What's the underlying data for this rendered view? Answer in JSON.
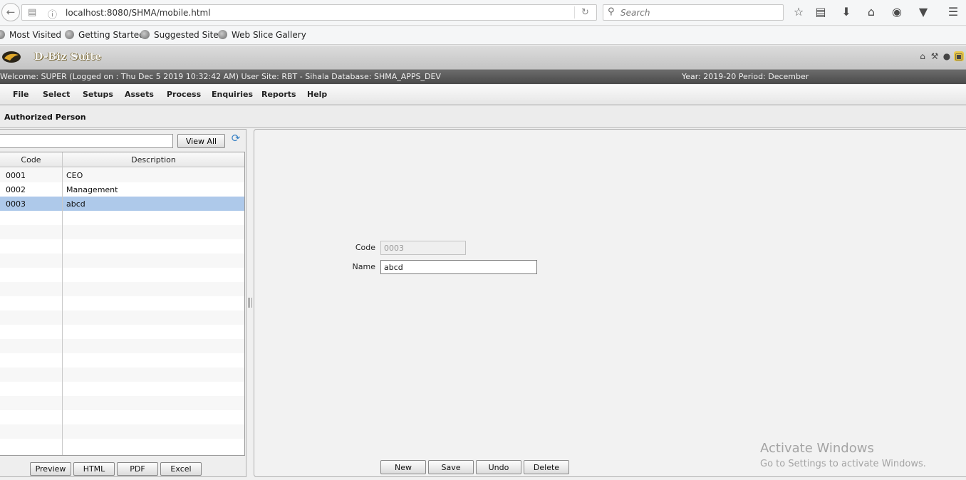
{
  "browser": {
    "url": "localhost:8080/SHMA/mobile.html",
    "search_placeholder": "Search"
  },
  "bookmarks": [
    "Most Visited",
    "Getting Started",
    "Suggested Sites",
    "Web Slice Gallery"
  ],
  "app": {
    "brand": "D-Biz Suite",
    "welcome": "Welcome: SUPER (Logged on : Thu Dec 5 2019 10:32:42 AM) User Site: RBT - Sihala Database: SHMA_APPS_DEV",
    "year_period": "Year: 2019-20 Period: December"
  },
  "menu": [
    "File",
    "Select",
    "Setups",
    "Assets",
    "Process",
    "Enquiries",
    "Reports",
    "Help"
  ],
  "page": {
    "title": "Authorized Person"
  },
  "left": {
    "filter_value": "",
    "view_all_label": "View All",
    "columns": {
      "code": "Code",
      "description": "Description"
    },
    "rows": [
      {
        "code": "0001",
        "description": "CEO"
      },
      {
        "code": "0002",
        "description": "Management"
      },
      {
        "code": "0003",
        "description": "abcd"
      }
    ],
    "selected_row": 2,
    "export_buttons": [
      "Preview",
      "HTML",
      "PDF",
      "Excel"
    ]
  },
  "form": {
    "code_label": "Code",
    "code_value": "0003",
    "name_label": "Name",
    "name_value": "abcd",
    "actions": [
      "New",
      "Save",
      "Undo",
      "Delete"
    ]
  },
  "watermark": {
    "line1": "Activate Windows",
    "line2": "Go to Settings to activate Windows."
  }
}
